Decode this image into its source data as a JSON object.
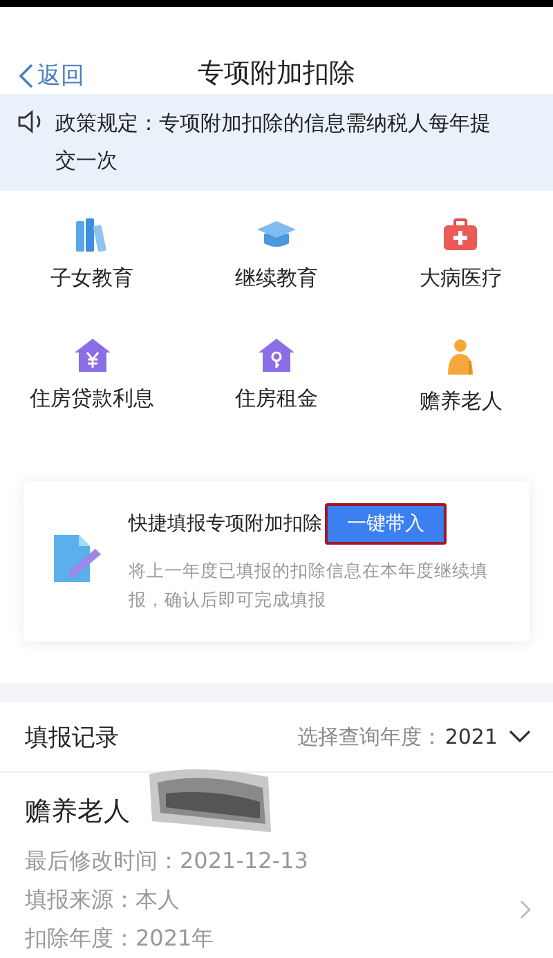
{
  "nav": {
    "back": "返回",
    "title": "专项附加扣除"
  },
  "notice": {
    "text": "政策规定：专项附加扣除的信息需纳税人每年提交一次"
  },
  "categories": [
    {
      "label": "子女教育",
      "kind": "books"
    },
    {
      "label": "继续教育",
      "kind": "cap"
    },
    {
      "label": "大病医疗",
      "kind": "medkit"
    },
    {
      "label": "住房贷款利息",
      "kind": "loan-house"
    },
    {
      "label": "住房租金",
      "kind": "key-house"
    },
    {
      "label": "赡养老人",
      "kind": "elder"
    }
  ],
  "quick_fill": {
    "title": "快捷填报专项附加扣除",
    "button": "一键带入",
    "highlighted": true,
    "description": "将上一年度已填报的扣除信息在本年度继续填报，确认后即可完成填报"
  },
  "records": {
    "title": "填报记录",
    "year_label": "选择查询年度：",
    "year": "2021",
    "items": [
      {
        "name": "赡养老人",
        "redacted": true,
        "lines": [
          "最后修改时间：2021-12-13",
          "填报来源：本人",
          "扣除年度：2021年"
        ]
      }
    ]
  }
}
